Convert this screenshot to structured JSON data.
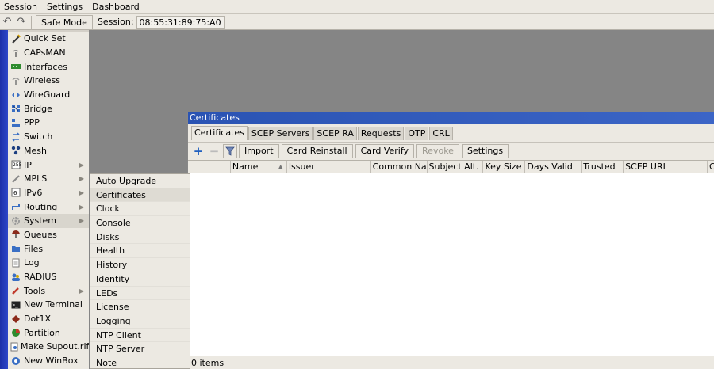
{
  "menubar": [
    "Session",
    "Settings",
    "Dashboard"
  ],
  "toolbar": {
    "undo_icon": "undo-icon",
    "redo_icon": "redo-icon",
    "safe_mode_label": "Safe Mode",
    "session_label": "Session:",
    "session_value": "08:55:31:89:75:A0"
  },
  "sidebar": {
    "items": [
      {
        "label": "Quick Set",
        "icon": "wand-icon",
        "arrow": false
      },
      {
        "label": "CAPsMAN",
        "icon": "antenna-icon",
        "arrow": false
      },
      {
        "label": "Interfaces",
        "icon": "interfaces-icon",
        "arrow": false
      },
      {
        "label": "Wireless",
        "icon": "wireless-icon",
        "arrow": false
      },
      {
        "label": "WireGuard",
        "icon": "wireguard-icon",
        "arrow": false
      },
      {
        "label": "Bridge",
        "icon": "bridge-icon",
        "arrow": false
      },
      {
        "label": "PPP",
        "icon": "ppp-icon",
        "arrow": false
      },
      {
        "label": "Switch",
        "icon": "switch-icon",
        "arrow": false
      },
      {
        "label": "Mesh",
        "icon": "mesh-icon",
        "arrow": false
      },
      {
        "label": "IP",
        "icon": "ip-icon",
        "arrow": true
      },
      {
        "label": "MPLS",
        "icon": "mpls-icon",
        "arrow": true
      },
      {
        "label": "IPv6",
        "icon": "ipv6-icon",
        "arrow": true
      },
      {
        "label": "Routing",
        "icon": "routing-icon",
        "arrow": true
      },
      {
        "label": "System",
        "icon": "system-gear-icon",
        "arrow": true,
        "active": true
      },
      {
        "label": "Queues",
        "icon": "queues-icon",
        "arrow": false
      },
      {
        "label": "Files",
        "icon": "folder-icon",
        "arrow": false
      },
      {
        "label": "Log",
        "icon": "log-icon",
        "arrow": false
      },
      {
        "label": "RADIUS",
        "icon": "radius-icon",
        "arrow": false
      },
      {
        "label": "Tools",
        "icon": "tools-icon",
        "arrow": true
      },
      {
        "label": "New Terminal",
        "icon": "terminal-icon",
        "arrow": false
      },
      {
        "label": "Dot1X",
        "icon": "dot1x-icon",
        "arrow": false
      },
      {
        "label": "Partition",
        "icon": "partition-icon",
        "arrow": false
      },
      {
        "label": "Make Supout.rif",
        "icon": "supout-icon",
        "arrow": false
      },
      {
        "label": "New WinBox",
        "icon": "winbox-icon",
        "arrow": false
      }
    ]
  },
  "submenu": {
    "items": [
      "Auto Upgrade",
      "Certificates",
      "Clock",
      "Console",
      "Disks",
      "Health",
      "History",
      "Identity",
      "LEDs",
      "License",
      "Logging",
      "NTP Client",
      "NTP Server",
      "Note"
    ],
    "selected": "Certificates"
  },
  "cert_window": {
    "title": "Certificates",
    "tabs": [
      "Certificates",
      "SCEP Servers",
      "SCEP RA",
      "Requests",
      "OTP",
      "CRL"
    ],
    "active_tab": "Certificates",
    "toolbar": {
      "add_icon": "plus-icon",
      "remove_icon": "minus-icon",
      "filter_icon": "filter-icon",
      "buttons": [
        {
          "label": "Import",
          "disabled": false
        },
        {
          "label": "Card Reinstall",
          "disabled": false
        },
        {
          "label": "Card Verify",
          "disabled": false
        },
        {
          "label": "Revoke",
          "disabled": true
        },
        {
          "label": "Settings",
          "disabled": false
        }
      ]
    },
    "columns": [
      "",
      "Name",
      "Issuer",
      "Common Name",
      "Subject Alt. N...",
      "Key Size",
      "Days Valid",
      "Trusted",
      "SCEP URL",
      "Ca"
    ],
    "status": "0 items"
  },
  "colors": {
    "title_bar": "#2a53b3",
    "left_strip": "#1b2fa8",
    "workspace": "#858585",
    "panel": "#ece9e2"
  }
}
